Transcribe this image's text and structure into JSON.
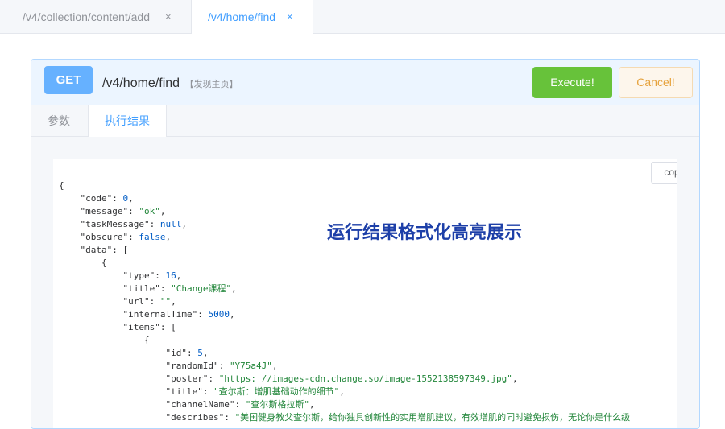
{
  "tabs": [
    {
      "label": "/v4/collection/content/add",
      "close": "×"
    },
    {
      "label": "/v4/home/find",
      "close": "×"
    }
  ],
  "request": {
    "method": "GET",
    "path": "/v4/home/find",
    "note": "【发现主页】",
    "execute_label": "Execute!",
    "cancel_label": "Cancel!"
  },
  "subtabs": [
    {
      "label": "参数"
    },
    {
      "label": "执行结果"
    }
  ],
  "result": {
    "copy_label": "copy",
    "overlay_text": "运行结果格式化高亮展示",
    "lines": [
      {
        "indent": 0,
        "parts": [
          {
            "t": "{",
            "c": "p"
          }
        ]
      },
      {
        "indent": 1,
        "parts": [
          {
            "t": "\"code\"",
            "c": "k"
          },
          {
            "t": ": ",
            "c": "p"
          },
          {
            "t": "0",
            "c": "n"
          },
          {
            "t": ",",
            "c": "p"
          }
        ]
      },
      {
        "indent": 1,
        "parts": [
          {
            "t": "\"message\"",
            "c": "k"
          },
          {
            "t": ": ",
            "c": "p"
          },
          {
            "t": "\"ok\"",
            "c": "s"
          },
          {
            "t": ",",
            "c": "p"
          }
        ]
      },
      {
        "indent": 1,
        "parts": [
          {
            "t": "\"taskMessage\"",
            "c": "k"
          },
          {
            "t": ": ",
            "c": "p"
          },
          {
            "t": "null",
            "c": "n"
          },
          {
            "t": ",",
            "c": "p"
          }
        ]
      },
      {
        "indent": 1,
        "parts": [
          {
            "t": "\"obscure\"",
            "c": "k"
          },
          {
            "t": ": ",
            "c": "p"
          },
          {
            "t": "false",
            "c": "n"
          },
          {
            "t": ",",
            "c": "p"
          }
        ]
      },
      {
        "indent": 1,
        "parts": [
          {
            "t": "\"data\"",
            "c": "k"
          },
          {
            "t": ": [",
            "c": "p"
          }
        ]
      },
      {
        "indent": 2,
        "parts": [
          {
            "t": "{",
            "c": "p"
          }
        ]
      },
      {
        "indent": 3,
        "parts": [
          {
            "t": "\"type\"",
            "c": "k"
          },
          {
            "t": ": ",
            "c": "p"
          },
          {
            "t": "16",
            "c": "n"
          },
          {
            "t": ",",
            "c": "p"
          }
        ]
      },
      {
        "indent": 3,
        "parts": [
          {
            "t": "\"title\"",
            "c": "k"
          },
          {
            "t": ": ",
            "c": "p"
          },
          {
            "t": "\"Change课程\"",
            "c": "s"
          },
          {
            "t": ",",
            "c": "p"
          }
        ]
      },
      {
        "indent": 3,
        "parts": [
          {
            "t": "\"url\"",
            "c": "k"
          },
          {
            "t": ": ",
            "c": "p"
          },
          {
            "t": "\"\"",
            "c": "s"
          },
          {
            "t": ",",
            "c": "p"
          }
        ]
      },
      {
        "indent": 3,
        "parts": [
          {
            "t": "\"internalTime\"",
            "c": "k"
          },
          {
            "t": ": ",
            "c": "p"
          },
          {
            "t": "5000",
            "c": "n"
          },
          {
            "t": ",",
            "c": "p"
          }
        ]
      },
      {
        "indent": 3,
        "parts": [
          {
            "t": "\"items\"",
            "c": "k"
          },
          {
            "t": ": [",
            "c": "p"
          }
        ]
      },
      {
        "indent": 4,
        "parts": [
          {
            "t": "{",
            "c": "p"
          }
        ]
      },
      {
        "indent": 5,
        "parts": [
          {
            "t": "\"id\"",
            "c": "k"
          },
          {
            "t": ": ",
            "c": "p"
          },
          {
            "t": "5",
            "c": "n"
          },
          {
            "t": ",",
            "c": "p"
          }
        ]
      },
      {
        "indent": 5,
        "parts": [
          {
            "t": "\"randomId\"",
            "c": "k"
          },
          {
            "t": ": ",
            "c": "p"
          },
          {
            "t": "\"Y75a4J\"",
            "c": "s"
          },
          {
            "t": ",",
            "c": "p"
          }
        ]
      },
      {
        "indent": 5,
        "parts": [
          {
            "t": "\"poster\"",
            "c": "k"
          },
          {
            "t": ": ",
            "c": "p"
          },
          {
            "t": "\"https: //images-cdn.change.so/image-1552138597349.jpg\"",
            "c": "s"
          },
          {
            "t": ",",
            "c": "p"
          }
        ]
      },
      {
        "indent": 5,
        "parts": [
          {
            "t": "\"title\"",
            "c": "k"
          },
          {
            "t": ": ",
            "c": "p"
          },
          {
            "t": "\"查尔斯：增肌基础动作的细节\"",
            "c": "s"
          },
          {
            "t": ",",
            "c": "p"
          }
        ]
      },
      {
        "indent": 5,
        "parts": [
          {
            "t": "\"channelName\"",
            "c": "k"
          },
          {
            "t": ": ",
            "c": "p"
          },
          {
            "t": "\"查尔斯格拉斯\"",
            "c": "s"
          },
          {
            "t": ",",
            "c": "p"
          }
        ]
      },
      {
        "indent": 5,
        "parts": [
          {
            "t": "\"describes\"",
            "c": "k"
          },
          {
            "t": ": ",
            "c": "p"
          },
          {
            "t": "\"美国健身教父查尔斯，给你独具创新性的实用增肌建议，有效增肌的同时避免损伤，无论你是什么级",
            "c": "s"
          }
        ]
      }
    ]
  }
}
